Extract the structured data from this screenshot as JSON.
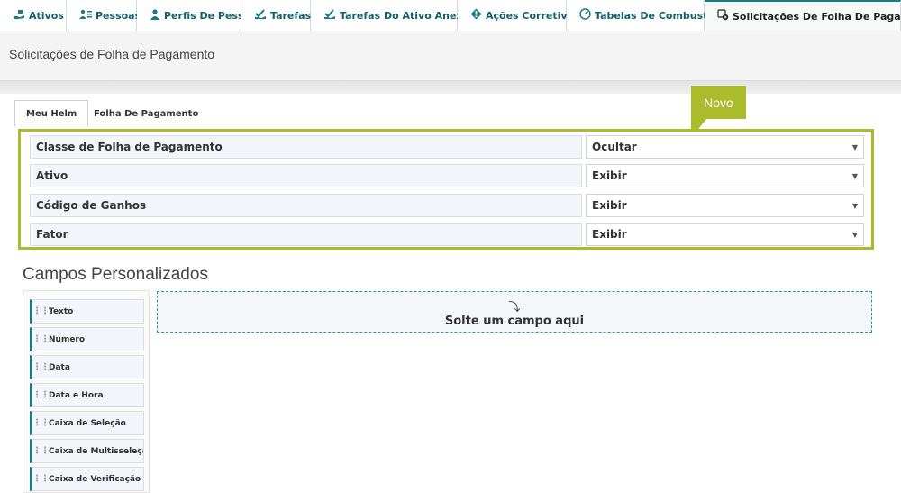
{
  "top_tabs": [
    {
      "label": "Ativos",
      "icon": "hand-box-icon"
    },
    {
      "label": "Pessoas",
      "icon": "people-icon"
    },
    {
      "label": "Perfis De Pessoa",
      "icon": "person-icon"
    },
    {
      "label": "Tarefas",
      "icon": "tasks-icon"
    },
    {
      "label": "Tarefas Do Ativo Anexado",
      "icon": "tasks-asset-icon"
    },
    {
      "label": "Ações Corretivas",
      "icon": "corrective-icon"
    },
    {
      "label": "Tabelas De Combustível",
      "icon": "gauge-icon"
    },
    {
      "label": "Solicitações De Folha De Pagamento",
      "icon": "payroll-request-icon"
    }
  ],
  "active_top_tab": "Solicitações De Folha De Pagamento",
  "page": {
    "title": "Solicitações de Folha de Pagamento"
  },
  "inner_tabs": [
    "Meu Helm",
    "Folha De Pagamento"
  ],
  "active_inner_tab": "Meu Helm",
  "fields": [
    {
      "label": "Classe de Folha de Pagamento",
      "value": "Ocultar"
    },
    {
      "label": "Ativo",
      "value": "Exibir"
    },
    {
      "label": "Código de Ganhos",
      "value": "Exibir"
    },
    {
      "label": "Fator",
      "value": "Exibir"
    }
  ],
  "callout": {
    "text": "Novo",
    "color": "#aabb2c"
  },
  "custom_fields": {
    "title": "Campos Personalizados",
    "palette": [
      "Texto",
      "Número",
      "Data",
      "Data e Hora",
      "Caixa de Seleção",
      "Caixa de Multisseleção",
      "Caixa de Verificação"
    ],
    "dropzone_text": "Solte um campo aqui"
  },
  "colors": {
    "accent": "#1b7a84",
    "highlight": "#aabb2c",
    "link": "#125e6a"
  }
}
